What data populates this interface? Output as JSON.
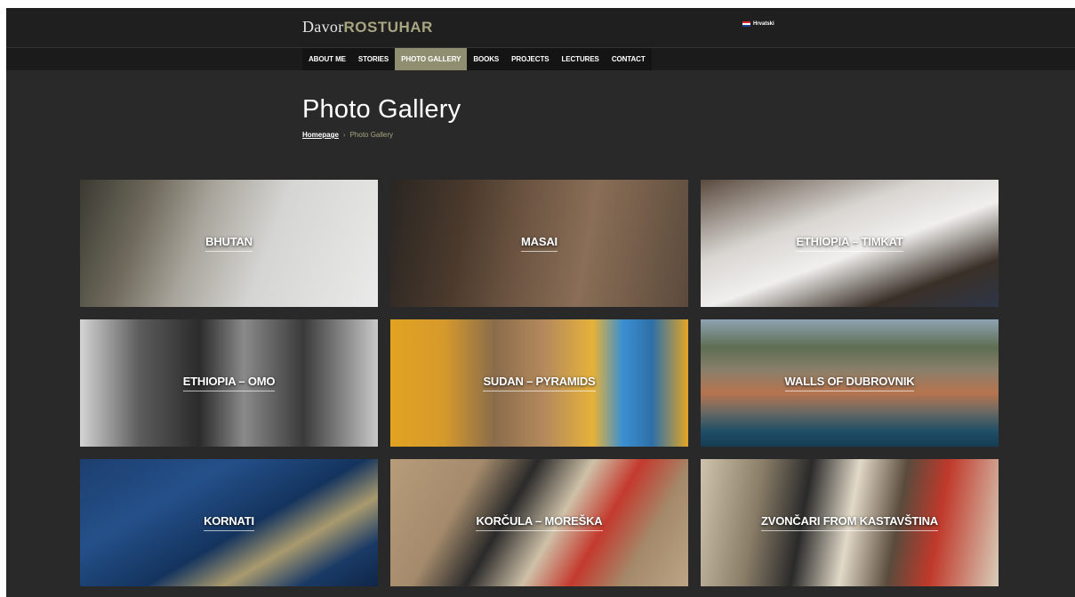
{
  "header": {
    "logo_first": "Davor",
    "logo_last": "ROSTUHAR",
    "language": "Hrvatski"
  },
  "nav": {
    "items": [
      {
        "label": "ABOUT ME",
        "active": false
      },
      {
        "label": "STORIES",
        "active": false
      },
      {
        "label": "PHOTO GALLERY",
        "active": true
      },
      {
        "label": "BOOKS",
        "active": false
      },
      {
        "label": "PROJECTS",
        "active": false
      },
      {
        "label": "LECTURES",
        "active": false
      },
      {
        "label": "CONTACT",
        "active": false
      }
    ]
  },
  "page": {
    "title": "Photo Gallery",
    "breadcrumb_home": "Homepage",
    "breadcrumb_separator": "›",
    "breadcrumb_current": "Photo Gallery"
  },
  "gallery": {
    "items": [
      {
        "label": "BHUTAN"
      },
      {
        "label": "MASAI"
      },
      {
        "label": "ETHIOPIA – TIMKAT"
      },
      {
        "label": "ETHIOPIA – OMO"
      },
      {
        "label": "SUDAN – PYRAMIDS"
      },
      {
        "label": "WALLS OF DUBROVNIK"
      },
      {
        "label": "KORNATI"
      },
      {
        "label": "KORČULA – MOREŠKA"
      },
      {
        "label": "ZVONČARI FROM KASTAVŠTINA"
      }
    ]
  },
  "colors": {
    "accent": "#8f8e70",
    "background": "#292929",
    "topbar": "#1f1f1f"
  }
}
